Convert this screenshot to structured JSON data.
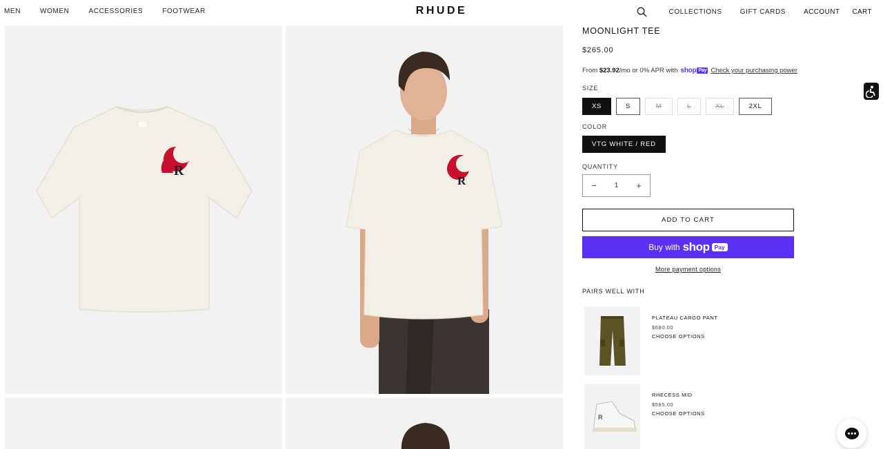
{
  "header": {
    "nav_left": [
      "MEN",
      "WOMEN",
      "ACCESSORIES",
      "FOOTWEAR"
    ],
    "brand": "RHUDE",
    "nav_right": {
      "collections": "COLLECTIONS",
      "gift_cards": "GIFT CARDS",
      "account": "ACCOUNT",
      "cart": "CART"
    }
  },
  "product": {
    "title": "MOONLIGHT TEE",
    "price": "$265.00",
    "installments": {
      "prefix": "From",
      "amount": "$23.92",
      "suffix": "/mo or 0% APR with",
      "shop_word": "shop",
      "pay_word": "Pay",
      "link": "Check your purchasing power"
    },
    "size_label": "SIZE",
    "sizes": [
      {
        "label": "XS",
        "state": "selected"
      },
      {
        "label": "S",
        "state": "available"
      },
      {
        "label": "M",
        "state": "soldout"
      },
      {
        "label": "L",
        "state": "soldout"
      },
      {
        "label": "XL",
        "state": "soldout"
      },
      {
        "label": "2XL",
        "state": "available"
      }
    ],
    "color_label": "COLOR",
    "color_value": "VTG WHITE / RED",
    "quantity_label": "QUANTITY",
    "quantity": "1",
    "minus": "−",
    "plus": "+",
    "add_to_cart": "ADD TO CART",
    "buy_now": {
      "prefix": "Buy with",
      "shop_word": "shop",
      "pay_word": "Pay"
    },
    "more_payment": "More payment options"
  },
  "pairs": {
    "title": "PAIRS WELL WITH",
    "items": [
      {
        "name": "PLATEAU CARGO PANT",
        "price": "$680.00",
        "action": "CHOOSE OPTIONS",
        "icon": "cargo-pant"
      },
      {
        "name": "RHECESS MID",
        "price": "$595.00",
        "action": "CHOOSE OPTIONS",
        "icon": "sneaker"
      }
    ]
  },
  "colors": {
    "accent": "#5a31f4",
    "tile_bg": "#f1f2f1",
    "logo_red": "#c8102e",
    "tee": "#f3efe6"
  },
  "icons": [
    "search-icon",
    "accessibility-icon",
    "chat-icon"
  ]
}
